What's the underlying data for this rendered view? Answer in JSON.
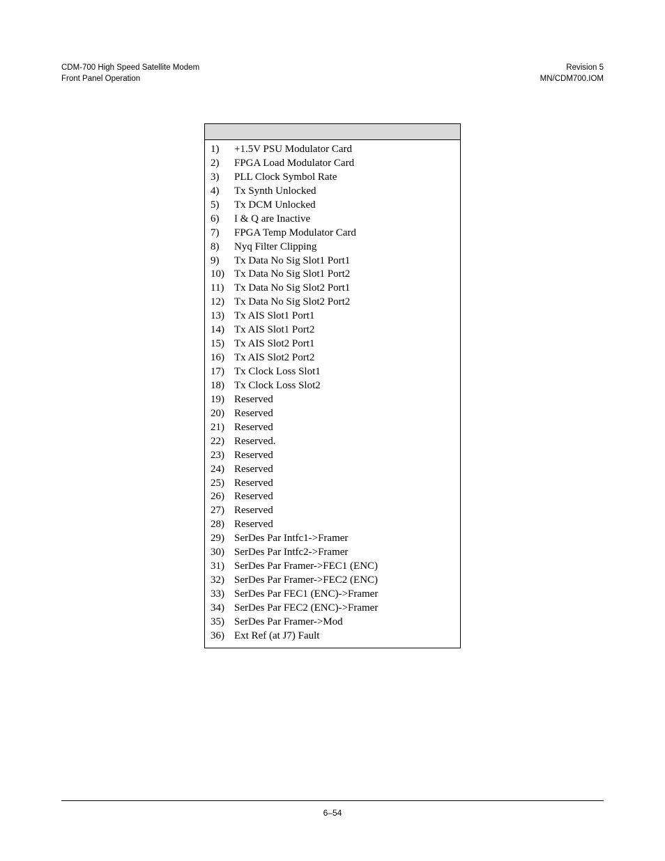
{
  "header": {
    "left_line1": "CDM-700 High Speed Satellite Modem",
    "left_line2": "Front Panel Operation",
    "right_line1": "Revision 5",
    "right_line2": "MN/CDM700.IOM"
  },
  "table": {
    "header_label": "",
    "items": [
      {
        "n": "1)",
        "t": "+1.5V PSU Modulator Card"
      },
      {
        "n": "2)",
        "t": "FPGA Load Modulator Card"
      },
      {
        "n": "3)",
        "t": "PLL Clock Symbol Rate"
      },
      {
        "n": "4)",
        "t": "Tx Synth Unlocked"
      },
      {
        "n": "5)",
        "t": "Tx DCM Unlocked"
      },
      {
        "n": "6)",
        "t": "I & Q are Inactive"
      },
      {
        "n": "7)",
        "t": "FPGA Temp Modulator Card"
      },
      {
        "n": "8)",
        "t": "Nyq Filter Clipping"
      },
      {
        "n": "9)",
        "t": "Tx Data No Sig Slot1 Port1"
      },
      {
        "n": "10)",
        "t": "Tx Data No Sig Slot1 Port2"
      },
      {
        "n": "11)",
        "t": "Tx Data No Sig Slot2 Port1"
      },
      {
        "n": "12)",
        "t": "Tx Data No Sig Slot2 Port2"
      },
      {
        "n": "13)",
        "t": "Tx AIS Slot1 Port1"
      },
      {
        "n": "14)",
        "t": "Tx AIS Slot1 Port2"
      },
      {
        "n": "15)",
        "t": "Tx AIS Slot2 Port1"
      },
      {
        "n": "16)",
        "t": "Tx AIS Slot2 Port2"
      },
      {
        "n": "17)",
        "t": "Tx Clock Loss Slot1"
      },
      {
        "n": "18)",
        "t": "Tx Clock Loss Slot2"
      },
      {
        "n": "19)",
        "t": "Reserved"
      },
      {
        "n": "20)",
        "t": "Reserved"
      },
      {
        "n": "21)",
        "t": "Reserved"
      },
      {
        "n": "22)",
        "t": "Reserved."
      },
      {
        "n": "23)",
        "t": "Reserved"
      },
      {
        "n": "24)",
        "t": "Reserved"
      },
      {
        "n": "25)",
        "t": "Reserved"
      },
      {
        "n": "26)",
        "t": "Reserved"
      },
      {
        "n": "27)",
        "t": "Reserved"
      },
      {
        "n": "28)",
        "t": "Reserved"
      },
      {
        "n": "29)",
        "t": "SerDes Par Intfc1->Framer"
      },
      {
        "n": "30)",
        "t": "SerDes Par Intfc2->Framer"
      },
      {
        "n": "31)",
        "t": "SerDes Par Framer->FEC1 (ENC)"
      },
      {
        "n": "32)",
        "t": "SerDes Par Framer->FEC2 (ENC)"
      },
      {
        "n": "33)",
        "t": "SerDes Par FEC1 (ENC)->Framer"
      },
      {
        "n": "34)",
        "t": "SerDes Par FEC2 (ENC)->Framer"
      },
      {
        "n": "35)",
        "t": "SerDes Par Framer->Mod"
      },
      {
        "n": "36)",
        "t": "Ext Ref (at J7) Fault"
      }
    ]
  },
  "footer": {
    "page_number": "6–54"
  }
}
